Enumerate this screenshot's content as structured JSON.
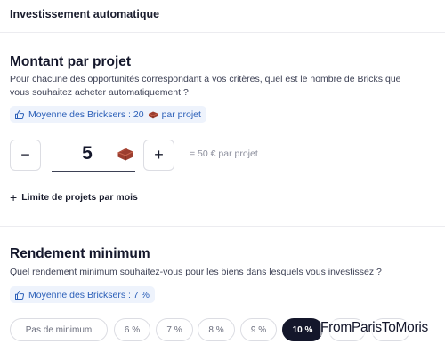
{
  "header": {
    "title": "Investissement automatique"
  },
  "amount_section": {
    "title": "Montant par projet",
    "description_line1": "Pour chacune des opportunités correspondant à vos critères, quel est le nombre de Bricks que",
    "description_line2": "vous souhaitez acheter automatiquement ?",
    "hint_prefix": "Moyenne des Bricksers : 20",
    "hint_suffix": "par projet",
    "decrement_label": "−",
    "quantity": "5",
    "increment_label": "+",
    "equivalent": "= 50 € par projet",
    "limit_plus": "+",
    "limit_label": "Limite de projets par mois"
  },
  "yield_section": {
    "title": "Rendement minimum",
    "description": "Quel rendement minimum souhaitez-vous pour les biens dans lesquels vous investissez ?",
    "hint": "Moyenne des Bricksers : 7 %",
    "options": [
      {
        "label": "Pas de minimum",
        "selected": false
      },
      {
        "label": "6 %",
        "selected": false
      },
      {
        "label": "7 %",
        "selected": false
      },
      {
        "label": "8 %",
        "selected": false
      },
      {
        "label": "9 %",
        "selected": false
      },
      {
        "label": "10 %",
        "selected": true
      },
      {
        "label": "",
        "selected": false
      },
      {
        "label": "",
        "selected": false
      }
    ]
  },
  "watermark": "FromParisToMoris",
  "icons": {
    "hint": "thumbs-up-icon",
    "brick": "brick-icon"
  },
  "colors": {
    "accent": "#2b5fb8",
    "hint_bg": "#eef3fc",
    "selected": "#14172b",
    "brick": "#9c3d2e"
  }
}
